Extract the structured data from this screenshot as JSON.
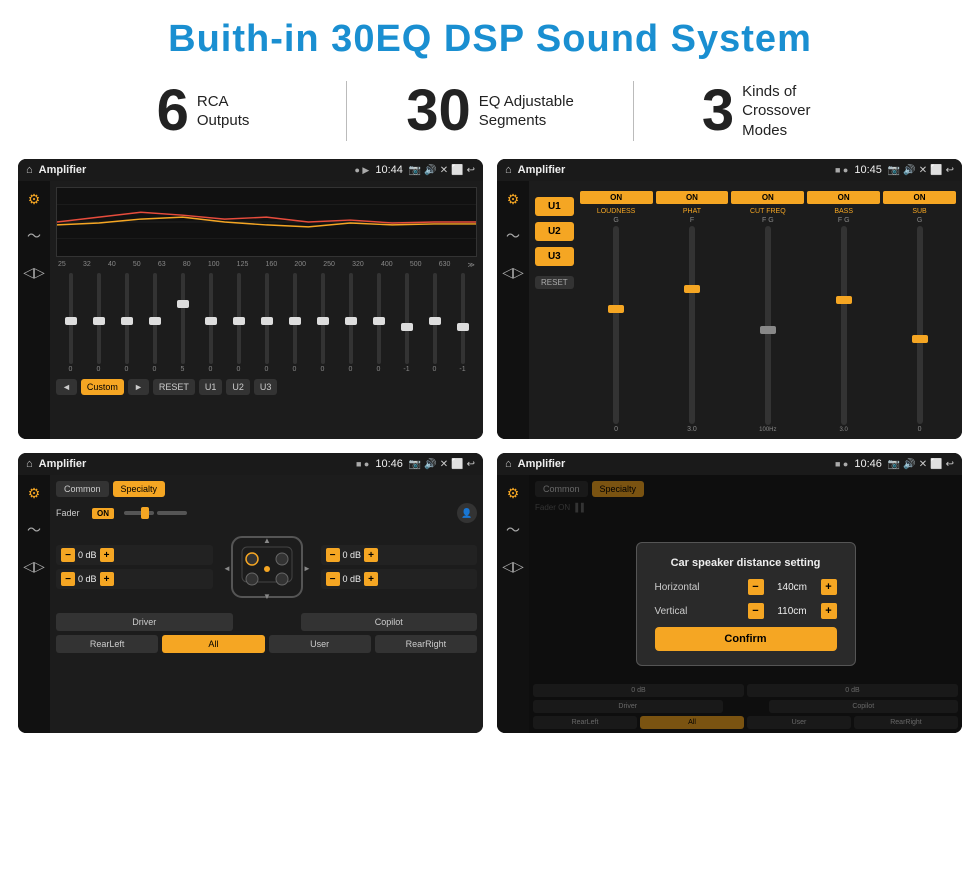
{
  "title": "Buith-in 30EQ DSP Sound System",
  "stats": [
    {
      "number": "6",
      "label": "RCA\nOutputs"
    },
    {
      "number": "30",
      "label": "EQ Adjustable\nSegments"
    },
    {
      "number": "3",
      "label": "Kinds of\nCrossover Modes"
    }
  ],
  "screens": [
    {
      "id": "eq-screen",
      "statusBar": {
        "icon": "🏠",
        "title": "Amplifier",
        "time": "10:44"
      },
      "type": "eq"
    },
    {
      "id": "crossover-screen",
      "statusBar": {
        "icon": "🏠",
        "title": "Amplifier",
        "time": "10:45"
      },
      "type": "crossover"
    },
    {
      "id": "fader-screen",
      "statusBar": {
        "icon": "🏠",
        "title": "Amplifier",
        "time": "10:46"
      },
      "type": "fader"
    },
    {
      "id": "dialog-screen",
      "statusBar": {
        "icon": "🏠",
        "title": "Amplifier",
        "time": "10:46"
      },
      "type": "dialog"
    }
  ],
  "eq": {
    "frequencies": [
      "25",
      "32",
      "40",
      "50",
      "63",
      "80",
      "100",
      "125",
      "160",
      "200",
      "250",
      "320",
      "400",
      "500",
      "630"
    ],
    "values": [
      "0",
      "0",
      "0",
      "0",
      "5",
      "0",
      "0",
      "0",
      "0",
      "0",
      "0",
      "0",
      "-1",
      "0",
      "-1"
    ],
    "preset": "Custom",
    "buttons": [
      "◄",
      "Custom",
      "►",
      "RESET",
      "U1",
      "U2",
      "U3"
    ]
  },
  "crossover": {
    "uButtons": [
      "U1",
      "U2",
      "U3"
    ],
    "columns": [
      {
        "label": "LOUDNESS",
        "on": true
      },
      {
        "label": "PHAT",
        "on": true
      },
      {
        "label": "CUT FREQ",
        "on": true
      },
      {
        "label": "BASS",
        "on": true
      },
      {
        "label": "SUB",
        "on": true
      }
    ],
    "resetBtn": "RESET"
  },
  "fader": {
    "tabs": [
      "Common",
      "Specialty"
    ],
    "activeTab": "Specialty",
    "faderLabel": "Fader",
    "onLabel": "ON",
    "speakerControls": [
      {
        "label": "",
        "value": "0 dB"
      },
      {
        "label": "",
        "value": "0 dB"
      },
      {
        "label": "",
        "value": "0 dB"
      },
      {
        "label": "",
        "value": "0 dB"
      }
    ],
    "bottomButtons": [
      "Driver",
      "",
      "Copilot",
      "RearLeft",
      "All",
      "User",
      "RearRight"
    ]
  },
  "dialog": {
    "title": "Car speaker distance setting",
    "horizontal": {
      "label": "Horizontal",
      "value": "140cm"
    },
    "vertical": {
      "label": "Vertical",
      "value": "110cm"
    },
    "confirmBtn": "Confirm",
    "speakerRight1": "0 dB",
    "speakerRight2": "0 dB",
    "bottomButtons": [
      "Driver",
      "Copilot",
      "RearLeft",
      "All",
      "User",
      "RearRight"
    ]
  },
  "colors": {
    "accent": "#f5a623",
    "blue": "#1a8fd1",
    "dark": "#1c1c1c",
    "sidebar": "#111111"
  }
}
